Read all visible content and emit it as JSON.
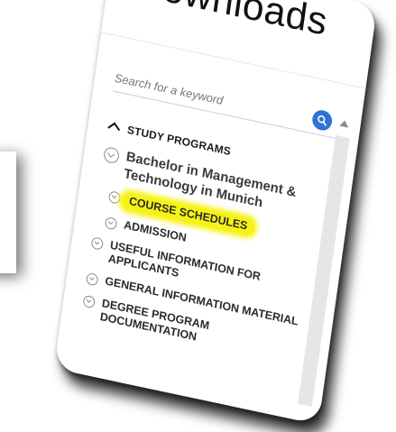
{
  "page": {
    "title": "Downloads"
  },
  "search": {
    "placeholder": "Search for a keyword"
  },
  "nav": {
    "section_label": "STUDY PROGRAMS",
    "program_label": "Bachelor in Management & Technology in Munich",
    "items": [
      {
        "label": "COURSE SCHEDULES",
        "highlighted": true
      },
      {
        "label": "ADMISSION",
        "highlighted": false
      },
      {
        "label": "USEFUL INFORMATION FOR APPLICANTS",
        "highlighted": false
      },
      {
        "label": "GENERAL INFORMATION MATERIAL",
        "highlighted": false
      },
      {
        "label": "DEGREE PROGRAM DOCUMENTATION",
        "highlighted": false
      }
    ]
  },
  "colors": {
    "accent": "#2f72d6",
    "highlight": "#f7f215",
    "text": "#1a1a1a"
  },
  "icons": {
    "search": "search-icon",
    "section_toggle": "caret-up-icon",
    "item_toggle": "chevron-circle-icon"
  }
}
